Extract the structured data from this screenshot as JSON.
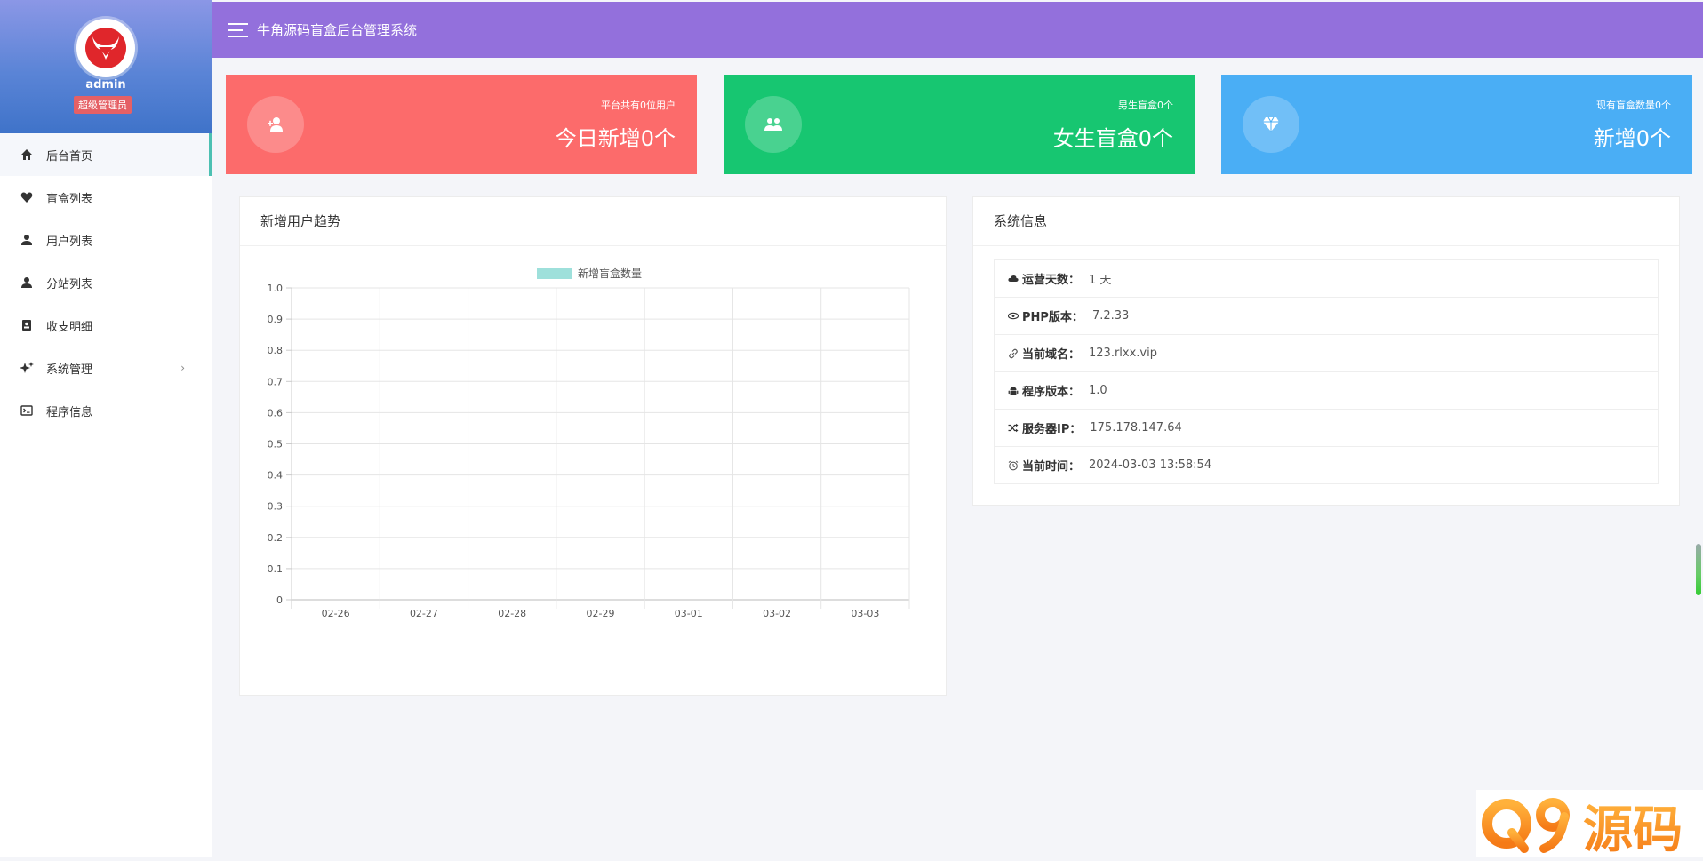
{
  "sidebar": {
    "username": "admin",
    "role": "超级管理员",
    "items": [
      {
        "label": "后台首页",
        "icon": "home-icon",
        "active": true
      },
      {
        "label": "盲盒列表",
        "icon": "heart-icon"
      },
      {
        "label": "用户列表",
        "icon": "person-icon"
      },
      {
        "label": "分站列表",
        "icon": "person-icon"
      },
      {
        "label": "收支明细",
        "icon": "contact-book-icon"
      },
      {
        "label": "系统管理",
        "icon": "sparkle-icon",
        "has_submenu": true
      },
      {
        "label": "程序信息",
        "icon": "terminal-icon"
      }
    ]
  },
  "header": {
    "title": "牛角源码盲盒后台管理系统"
  },
  "stats": [
    {
      "small": "平台共有0位用户",
      "big": "今日新增0个",
      "color": "#fc6b6b",
      "icon": "add-user-icon"
    },
    {
      "small": "男生盲盒0个",
      "big": "女生盲盒0个",
      "color": "#17c671",
      "icon": "users-icon"
    },
    {
      "small": "现有盲盒数量0个",
      "big": "新增0个",
      "color": "#4aaef5",
      "icon": "diamond-icon"
    }
  ],
  "chart_panel": {
    "title": "新增用户趋势"
  },
  "chart_data": {
    "type": "bar",
    "categories": [
      "02-26",
      "02-27",
      "02-28",
      "02-29",
      "03-01",
      "03-02",
      "03-03"
    ],
    "series": [
      {
        "name": "新增盲盒数量",
        "values": [
          0,
          0,
          0,
          0,
          0,
          0,
          0
        ],
        "color": "#9ee0db"
      }
    ],
    "ylim": [
      0,
      1.0
    ],
    "yticks": [
      "1.0",
      "0.9",
      "0.8",
      "0.7",
      "0.6",
      "0.5",
      "0.4",
      "0.3",
      "0.2",
      "0.1",
      "0"
    ],
    "grid": true,
    "legend": "top-center"
  },
  "info_panel": {
    "title": "系统信息",
    "rows": [
      {
        "icon": "cloud-icon",
        "label": "运营天数：",
        "value": "1 天"
      },
      {
        "icon": "eye-icon",
        "label": "PHP版本：",
        "value": "7.2.33"
      },
      {
        "icon": "link-icon",
        "label": "当前域名：",
        "value": "123.rlxx.vip"
      },
      {
        "icon": "android-icon",
        "label": "程序版本：",
        "value": "1.0"
      },
      {
        "icon": "shuffle-icon",
        "label": "服务器IP：",
        "value": "175.178.147.64"
      },
      {
        "icon": "alarm-icon",
        "label": "当前时间：",
        "value": "2024-03-03 13:58:54"
      }
    ]
  },
  "watermark": {
    "text": "Q9源码"
  }
}
